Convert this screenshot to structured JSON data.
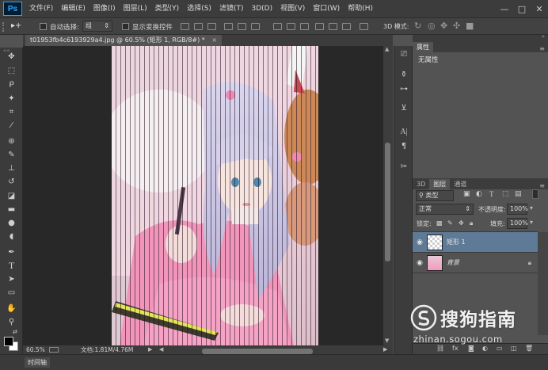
{
  "app": {
    "logo": "Ps"
  },
  "menu": [
    "文件(F)",
    "编辑(E)",
    "图像(I)",
    "图层(L)",
    "类型(Y)",
    "选择(S)",
    "滤镜(T)",
    "3D(D)",
    "视图(V)",
    "窗口(W)",
    "帮助(H)"
  ],
  "window_controls": {
    "minimize": "—",
    "restore": "□",
    "close": "✕"
  },
  "options": {
    "tool_glyph": "▸+",
    "auto_select_label": "自动选择:",
    "auto_select_value": "组",
    "show_transform_label": "显示变换控件",
    "mode_3d_label": "3D 模式:"
  },
  "document": {
    "tab_title": "t01953fb4c6193929a4.jpg @ 60.5% (矩形 1, RGB/8#) *",
    "tab_close": "×"
  },
  "status": {
    "zoom": "60.5%",
    "doc_info": "文档:1.81M/4.76M"
  },
  "timeline": {
    "label": "时间轴"
  },
  "properties_panel": {
    "tab_label": "属性",
    "content": "无属性"
  },
  "layers_panel": {
    "tabs": [
      "3D",
      "图层",
      "通道"
    ],
    "filter_kind": "类型",
    "blend_mode": "正常",
    "opacity_label": "不透明度:",
    "opacity_value": "100%",
    "lock_label": "锁定:",
    "fill_label": "填充:",
    "fill_value": "100%",
    "layers": [
      {
        "name": "矩形 1",
        "selected": true,
        "visible": true
      },
      {
        "name": "背景",
        "selected": false,
        "visible": true,
        "locked": true
      }
    ]
  },
  "watermark": {
    "brand": "搜狗指南",
    "url": "zhinan.sogou.com"
  },
  "colors": {
    "chrome": "#3c3c3c",
    "panel_bg": "#535353",
    "canvas_bg": "#282828",
    "selected_layer": "#5f7a96",
    "ps_blue": "#31a8ff"
  }
}
